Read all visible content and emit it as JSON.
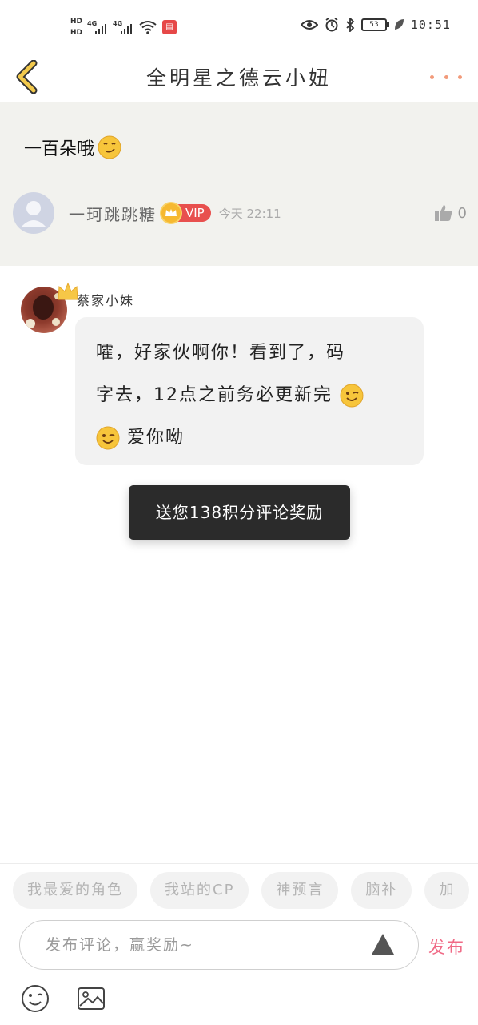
{
  "status_bar": {
    "hd1": "HD",
    "hd2": "HD",
    "net1": "4G",
    "net2": "4G",
    "battery": "53",
    "time": "10:51"
  },
  "nav": {
    "title": "全明星之德云小妞"
  },
  "featured_comment": {
    "text": "一百朵哦",
    "author": "一珂跳跳糖",
    "vip_label": "VIP",
    "time": "今天 22:11",
    "likes": "0"
  },
  "reply": {
    "author": "蔡家小妹",
    "line1": "嚯，好家伙啊你！看到了，码",
    "line2": "字去，12点之前务必更新完",
    "line3": "爱你呦"
  },
  "toast": {
    "text": "送您138积分评论奖励"
  },
  "quick_tags": [
    "我最爱的角色",
    "我站的CP",
    "神预言",
    "脑补",
    "加"
  ],
  "composer": {
    "placeholder": "发布评论，赢奖励~",
    "send_label": "发布"
  },
  "colors": {
    "accent_pink": "#f06a86",
    "vip_red": "#e8504e",
    "back_arrow": "#f2c94c",
    "more_dots": "#f29a7a"
  }
}
